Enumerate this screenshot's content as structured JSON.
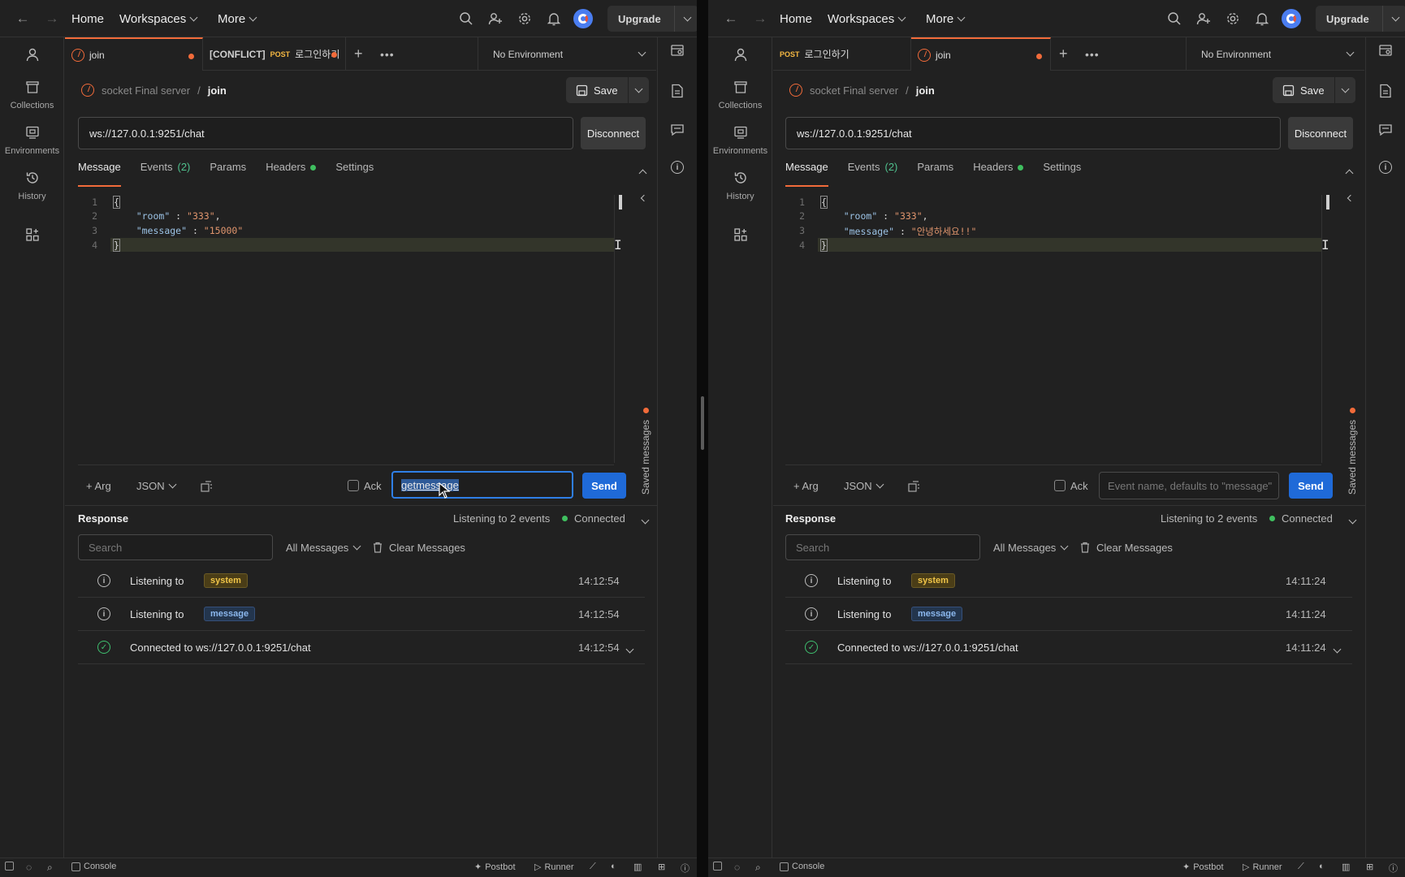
{
  "nav": {
    "home": "Home",
    "workspaces": "Workspaces",
    "more": "More",
    "upgrade": "Upgrade"
  },
  "sidebar": {
    "collections": "Collections",
    "environments": "Environments",
    "history": "History"
  },
  "status_bar": {
    "console": "Console",
    "postbot": "Postbot",
    "runner": "Runner"
  },
  "colors": {
    "accent": "#f26b3a",
    "send": "#1f6ad8",
    "connected": "#3fbf5f"
  },
  "left": {
    "tabs": [
      {
        "label": "join"
      },
      {
        "prefix": "[CONFLICT]",
        "method": "POST",
        "label": "로그인하기"
      }
    ],
    "environment": "No Environment",
    "breadcrumb": {
      "collection": "socket Final server",
      "sep": "/",
      "item": "join"
    },
    "save": "Save",
    "url": "ws://127.0.0.1:9251/chat",
    "disconnect": "Disconnect",
    "subtabs": {
      "message": "Message",
      "events": "Events",
      "events_count": "(2)",
      "params": "Params",
      "headers": "Headers",
      "settings": "Settings"
    },
    "code": {
      "l1": "1",
      "l2": "2",
      "l3": "3",
      "l4": "4",
      "open": "{",
      "k1": "\"room\"",
      "v1": "\"333\"",
      "k2": "\"message\"",
      "v2": "\"15000\"",
      "close": "}"
    },
    "saved_messages": "Saved messages",
    "arg": "+ Arg",
    "format": "JSON",
    "ack": "Ack",
    "event_value": "getmessage",
    "event_placeholder": "",
    "send": "Send",
    "response": {
      "title": "Response",
      "listening": "Listening to 2 events",
      "status": "Connected",
      "search_placeholder": "Search",
      "filter": "All Messages",
      "clear": "Clear Messages"
    },
    "rows": [
      {
        "text": "Listening to",
        "badge": "system",
        "time": "14:12:54"
      },
      {
        "text": "Listening to",
        "badge": "message",
        "time": "14:12:54"
      },
      {
        "text": "Connected to ws://127.0.0.1:9251/chat",
        "time": "14:12:54"
      }
    ]
  },
  "right": {
    "tabs": [
      {
        "method": "POST",
        "label": "로그인하기"
      },
      {
        "label": "join"
      }
    ],
    "environment": "No Environment",
    "breadcrumb": {
      "collection": "socket Final server",
      "sep": "/",
      "item": "join"
    },
    "save": "Save",
    "url": "ws://127.0.0.1:9251/chat",
    "disconnect": "Disconnect",
    "subtabs": {
      "message": "Message",
      "events": "Events",
      "events_count": "(2)",
      "params": "Params",
      "headers": "Headers",
      "settings": "Settings"
    },
    "code": {
      "l1": "1",
      "l2": "2",
      "l3": "3",
      "l4": "4",
      "open": "{",
      "k1": "\"room\"",
      "v1": "\"333\"",
      "k2": "\"message\"",
      "v2": "\"안녕하세요!!\"",
      "close": "}"
    },
    "saved_messages": "Saved messages",
    "arg": "+ Arg",
    "format": "JSON",
    "ack": "Ack",
    "event_placeholder": "Event name, defaults to \"message\"",
    "send": "Send",
    "response": {
      "title": "Response",
      "listening": "Listening to 2 events",
      "status": "Connected",
      "search_placeholder": "Search",
      "filter": "All Messages",
      "clear": "Clear Messages"
    },
    "rows": [
      {
        "text": "Listening to",
        "badge": "system",
        "time": "14:11:24"
      },
      {
        "text": "Listening to",
        "badge": "message",
        "time": "14:11:24"
      },
      {
        "text": "Connected to ws://127.0.0.1:9251/chat",
        "time": "14:11:24"
      }
    ]
  }
}
